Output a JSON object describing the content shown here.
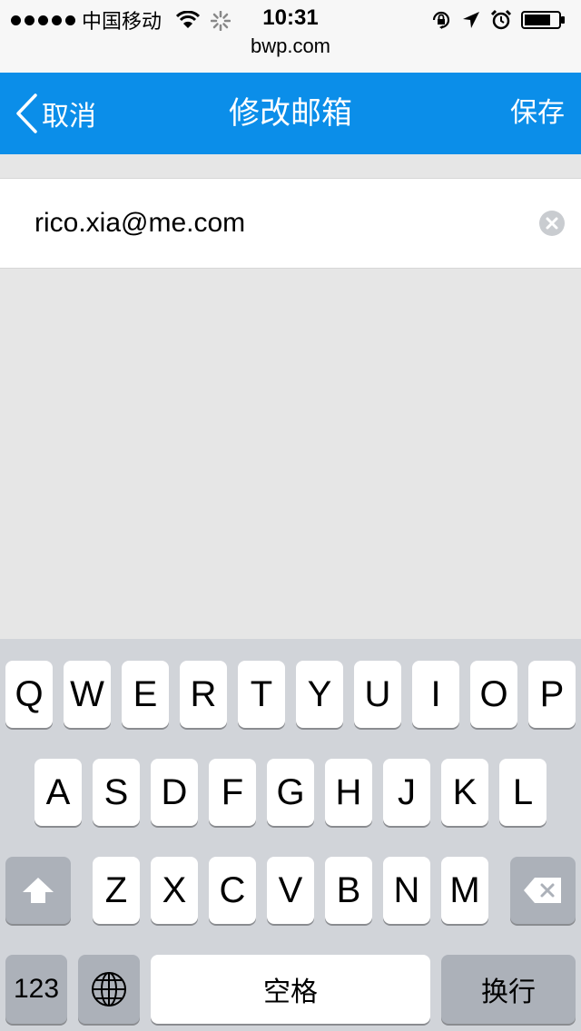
{
  "status_bar": {
    "carrier": "中国移动",
    "time": "10:31",
    "url": "bwp.com",
    "icons": [
      "signal-dots-icon",
      "wifi-icon",
      "activity-spinner-icon",
      "orientation-lock-icon",
      "location-arrow-icon",
      "alarm-icon",
      "battery-icon"
    ]
  },
  "nav": {
    "back_label": "取消",
    "title": "修改邮箱",
    "save_label": "保存",
    "color": "#0b8ee9"
  },
  "email_field": {
    "value": "rico.xia@me.com"
  },
  "keyboard": {
    "row1": [
      "Q",
      "W",
      "E",
      "R",
      "T",
      "Y",
      "U",
      "I",
      "O",
      "P"
    ],
    "row2": [
      "A",
      "S",
      "D",
      "F",
      "G",
      "H",
      "J",
      "K",
      "L"
    ],
    "row3": [
      "Z",
      "X",
      "C",
      "V",
      "B",
      "N",
      "M"
    ],
    "numbers_label": "123",
    "space_label": "空格",
    "return_label": "换行",
    "shift_icon": "shift-arrow-icon",
    "delete_icon": "backspace-icon",
    "globe_icon": "globe-icon"
  }
}
